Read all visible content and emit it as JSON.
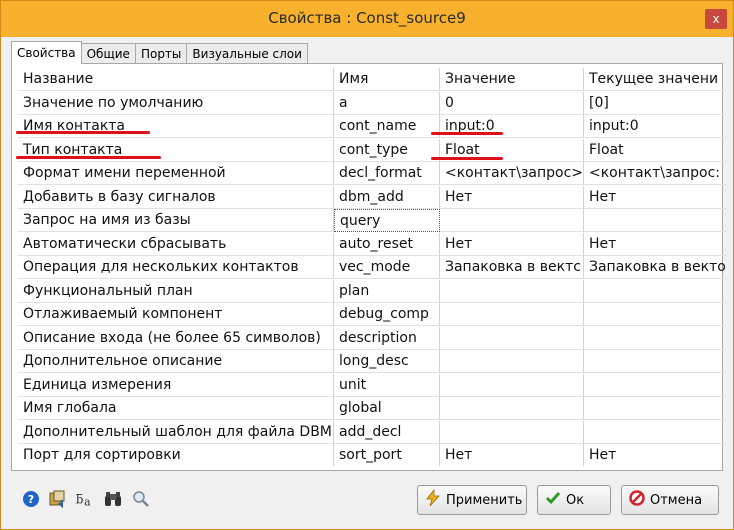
{
  "window": {
    "title": "Свойства :  Const_source9",
    "close_label": "x"
  },
  "tabs": [
    {
      "label": "Свойства",
      "active": true
    },
    {
      "label": "Общие",
      "active": false
    },
    {
      "label": "Порты",
      "active": false
    },
    {
      "label": "Визуальные слои",
      "active": false
    }
  ],
  "table": {
    "headers": [
      "Название",
      "Имя",
      "Значение",
      "Текущее значени"
    ],
    "rows": [
      [
        "Значение по умолчанию",
        "a",
        "0",
        "[0]"
      ],
      [
        "Имя контакта",
        "cont_name",
        "input:0",
        "input:0"
      ],
      [
        "Тип контакта",
        "cont_type",
        "Float",
        "Float"
      ],
      [
        "Формат имени переменной",
        "decl_format",
        "<контакт\\запрос>",
        "<контакт\\запрос:"
      ],
      [
        "Добавить в базу сигналов",
        "dbm_add",
        "Нет",
        "Нет"
      ],
      [
        "Запрос на имя из базы",
        "query",
        "",
        ""
      ],
      [
        "Автоматически сбрасывать",
        "auto_reset",
        "Нет",
        "Нет"
      ],
      [
        "Операция для нескольких контактов",
        "vec_mode",
        "Запаковка в вектс",
        "Запаковка в векто"
      ],
      [
        "Функциональный план",
        "plan",
        "",
        ""
      ],
      [
        "Отлаживаемый компонент",
        "debug_comp",
        "",
        ""
      ],
      [
        "Описание входа (не более 65 символов)",
        "description",
        "",
        ""
      ],
      [
        "Дополнительное описание",
        "long_desc",
        "",
        ""
      ],
      [
        "Единица измерения",
        "unit",
        "",
        ""
      ],
      [
        "Имя глобала",
        "global",
        "",
        ""
      ],
      [
        "Дополнительный шаблон для файла DBM",
        "add_decl",
        "",
        ""
      ],
      [
        "Порт для сортировки",
        "sort_port",
        "Нет",
        "Нет"
      ]
    ]
  },
  "annotation": {
    "color": "#e0101a"
  },
  "toolbar_icons": [
    "help-icon",
    "sort-icon",
    "rename-icon",
    "binoculars-icon",
    "magnifier-icon"
  ],
  "buttons": {
    "apply": "Применить",
    "ok": "Ок",
    "cancel": "Отмена"
  }
}
